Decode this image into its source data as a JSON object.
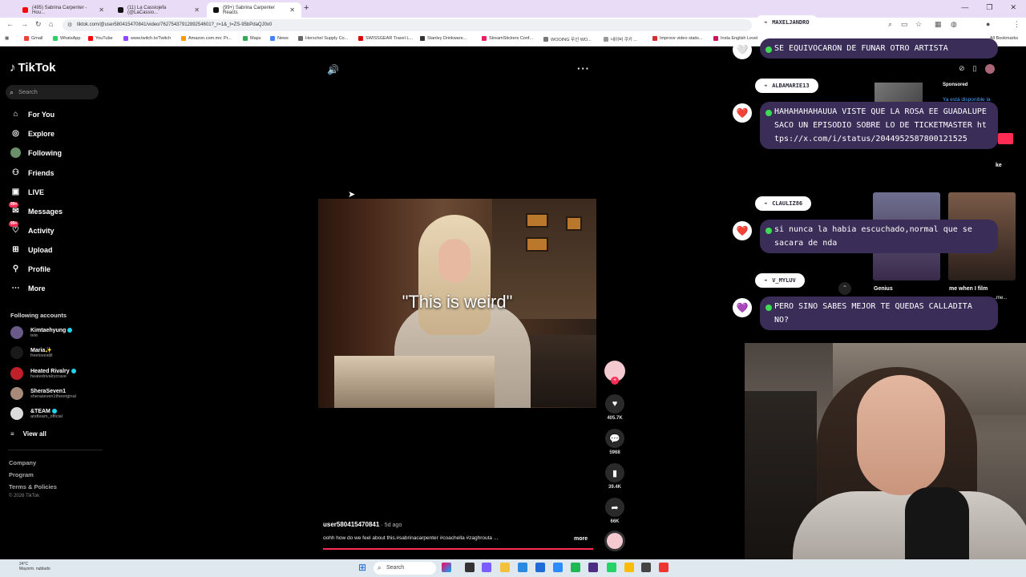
{
  "browser": {
    "tabs": [
      {
        "label": "(495) Sabrina Carpenter - Hou...",
        "color": "#ff0000"
      },
      {
        "label": "(11) La Cassiojefa (@LaCassio...",
        "color": "#111111"
      },
      {
        "label": "(99+) Sabrina Carpenter Reacts",
        "color": "#111111"
      }
    ],
    "url": "tiktok.com/@user580415470841/video/7627543791289254601?_r=1&_t=ZS-95bPdaQJ0x0",
    "bookmarks": [
      "Gmail",
      "WhatsApp",
      "YouTube",
      "www.twitch.tv/Twitch",
      "Amazon.com.mx: Pr...",
      "Maps",
      "News",
      "Herschel Supply Co...",
      "SWISSGEAR Travel L...",
      "Stanley Drinkware...",
      "StreamStickers Conf...",
      "WOOING 무선 WO...",
      "네이버 쿠키 ...",
      "Improve video statis...",
      "Insta English Level"
    ],
    "all_bookmarks": "All Bookmarks"
  },
  "tiktok": {
    "logo": "TikTok",
    "search_placeholder": "Search",
    "nav": [
      {
        "label": "For You",
        "icon": "home-icon"
      },
      {
        "label": "Explore",
        "icon": "compass-icon"
      },
      {
        "label": "Following",
        "icon": "following-avatar-icon"
      },
      {
        "label": "Friends",
        "icon": "friends-icon"
      },
      {
        "label": "LIVE",
        "icon": "live-icon"
      },
      {
        "label": "Messages",
        "icon": "messages-icon",
        "badge": "99+"
      },
      {
        "label": "Activity",
        "icon": "activity-icon",
        "badge": "99+"
      },
      {
        "label": "Upload",
        "icon": "upload-icon"
      },
      {
        "label": "Profile",
        "icon": "profile-icon"
      },
      {
        "label": "More",
        "icon": "more-icon"
      }
    ],
    "following_title": "Following accounts",
    "accounts": [
      {
        "name": "Kimtaehyung",
        "handle": "tete",
        "verified": true,
        "color": "#6a5a8a"
      },
      {
        "name": "Maria✨",
        "handle": "freelovestill",
        "verified": false,
        "color": "#1a1a1a"
      },
      {
        "name": "Heated Rivalry",
        "handle": "heatedrivalrycrave",
        "verified": true,
        "color": "#c0202a"
      },
      {
        "name": "SheraSeven1",
        "handle": "sheraseven1theoriginal",
        "verified": false,
        "color": "#a88a7a"
      },
      {
        "name": "&TEAM",
        "handle": "andteam_official",
        "verified": true,
        "color": "#dcdcdc"
      }
    ],
    "view_all": "View all",
    "footer_links": [
      "Company",
      "Program",
      "Terms & Policies"
    ],
    "copyright": "© 2026 TikTok",
    "video": {
      "caption": "\"This is weird\"",
      "username": "user580415470841",
      "time_ago": "· 5d ago",
      "description": "oohh how do we feel about this.#sabrinacarpenter #coachella #zaghrouta ...",
      "more": "more",
      "likes": "405.7K",
      "comments": "5968",
      "saves": "39.4K",
      "shares": "66K"
    },
    "right": {
      "sponsored": "Sponsored",
      "sponsored_text": "Ya está disponible la",
      "sponsored_cta_tail": "ke",
      "thumbs": [
        {
          "label": "Genius",
          "color1": "#6f6f8f",
          "color2": "#3a2a4a"
        },
        {
          "label": "me when I film",
          "color1": "#7a5a48",
          "color2": "#2a1f1a"
        }
      ],
      "thumb2_sub": "...me..."
    }
  },
  "chat": [
    {
      "user": "MAXELJANDRO",
      "message": "SE EQUIVOCARON DE FUNAR OTRO ARTISTA",
      "heart": "🤍"
    },
    {
      "user": "ALBAMARIE13",
      "message": "HAHAHAHAHAUUA VISTE QUE LA ROSA EE GUADALUPE SACO UN EPISODIO SOBRE LO DE TICKETMASTER https://x.com/i/status/2044952587800121525",
      "heart": "❤️"
    },
    {
      "user": "CLAULIZ86",
      "message": "si nunca la habia escuchado,normal que se sacara de nda",
      "heart": "❤️"
    },
    {
      "user": "V_MYLUV",
      "message": "PERO SINO SABES MEJOR TE QUEDAS CALLADITA NO?",
      "heart": "💜"
    }
  ],
  "taskbar": {
    "weather_temp": "24°C",
    "weather_desc": "Mayorm. nublado",
    "search": "Search"
  }
}
